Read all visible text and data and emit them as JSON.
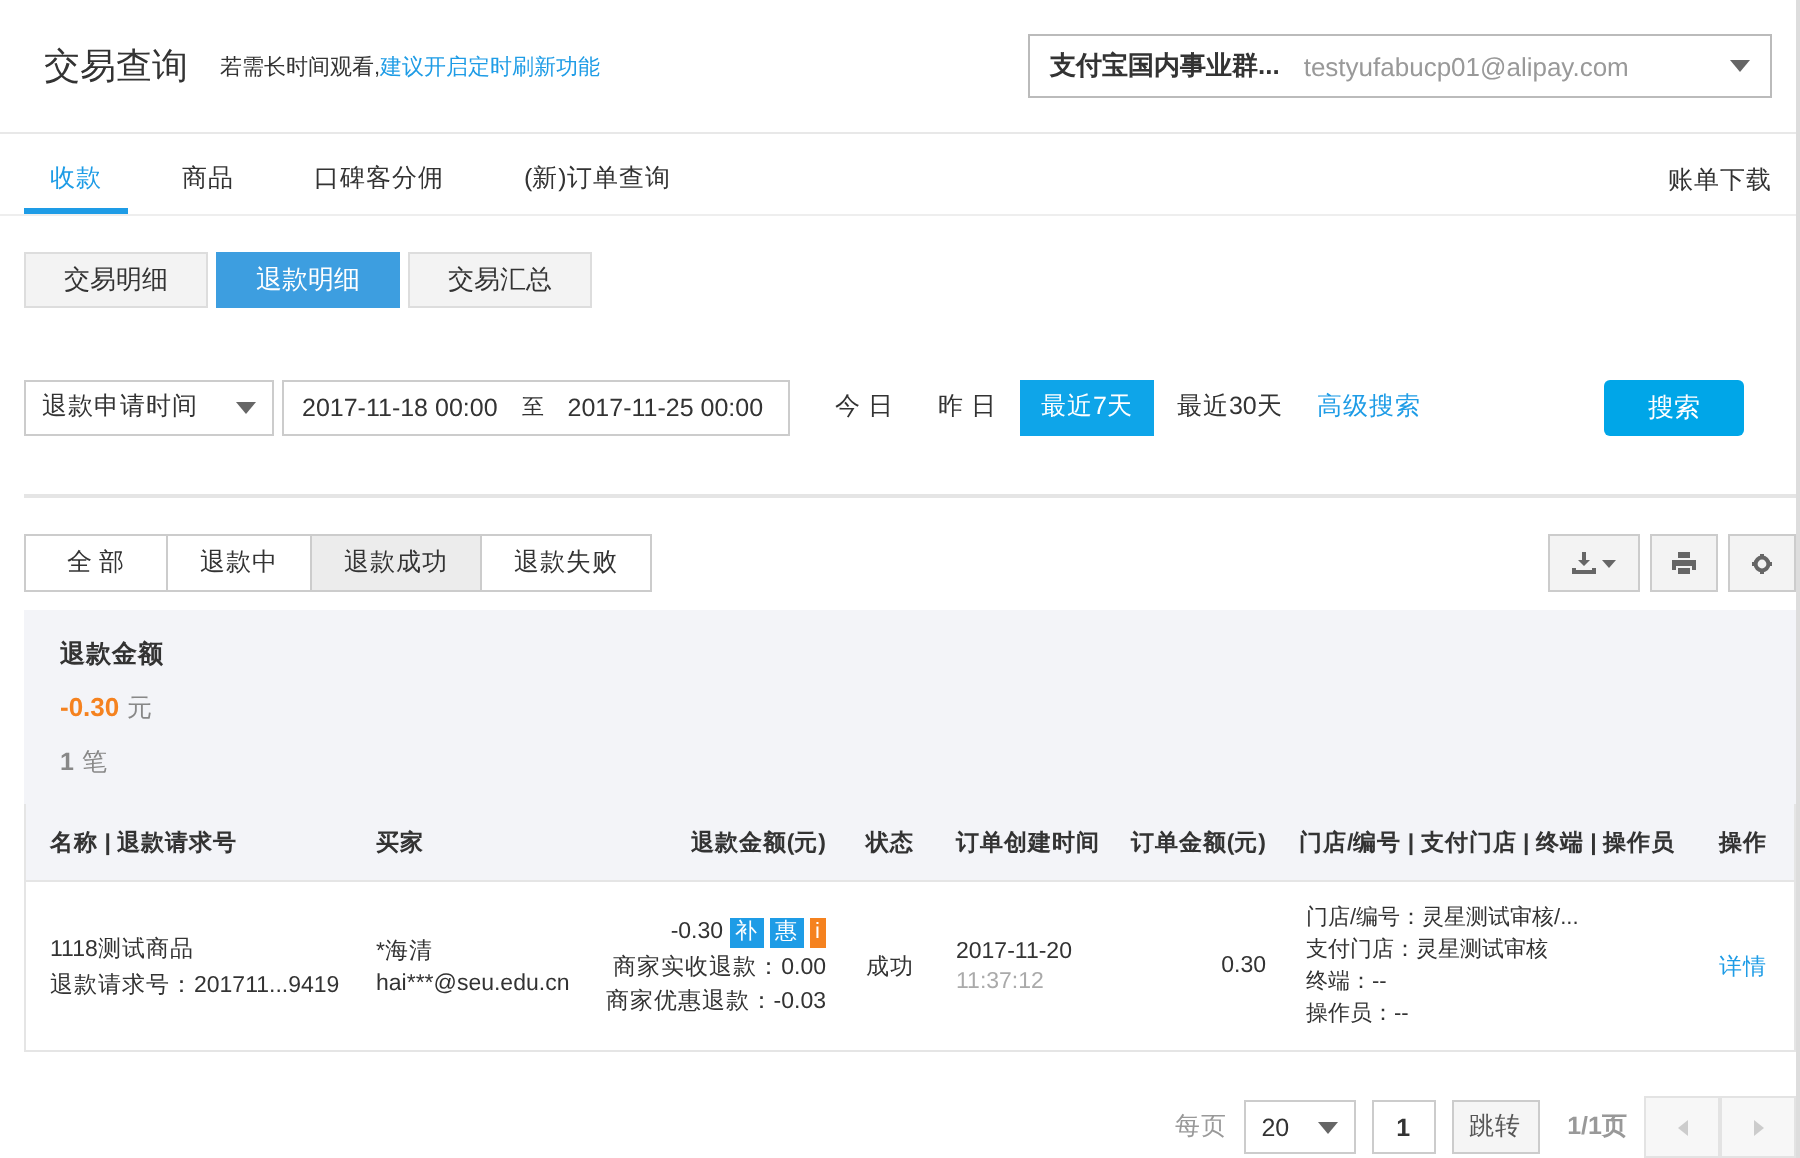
{
  "header": {
    "title": "交易查询",
    "hint": "若需长时间观看,",
    "hint_link": "建议开启定时刷新功能",
    "account": {
      "name": "支付宝国内事业群...",
      "email": "testyufabucp01@alipay.com"
    }
  },
  "nav_tabs": [
    {
      "label": "收款",
      "selected": true
    },
    {
      "label": "商品",
      "selected": false
    },
    {
      "label": "口碑客分佣",
      "selected": false
    },
    {
      "label": "(新)订单查询",
      "selected": false
    }
  ],
  "nav_right": "账单下载",
  "sub_tabs": [
    {
      "label": "交易明细",
      "selected": false
    },
    {
      "label": "退款明细",
      "selected": true
    },
    {
      "label": "交易汇总",
      "selected": false
    }
  ],
  "filter": {
    "time_type": "退款申请时间",
    "date_from": "2017-11-18 00:00",
    "date_sep": "至",
    "date_to": "2017-11-25 00:00",
    "ranges": [
      {
        "label": "今 日",
        "selected": false
      },
      {
        "label": "昨 日",
        "selected": false
      },
      {
        "label": "最近7天",
        "selected": true
      },
      {
        "label": "最近30天",
        "selected": false
      }
    ],
    "advanced": "高级搜索",
    "search": "搜索"
  },
  "status_tabs": [
    {
      "label": "全 部",
      "selected": false
    },
    {
      "label": "退款中",
      "selected": false
    },
    {
      "label": "退款成功",
      "selected": true
    },
    {
      "label": "退款失败",
      "selected": false
    }
  ],
  "summary": {
    "title": "退款金额",
    "amount": "-0.30",
    "unit": "元",
    "count": "1",
    "count_unit": "笔"
  },
  "table": {
    "columns": [
      "名称 | 退款请求号",
      "买家",
      "退款金额(元)",
      "状态",
      "订单创建时间",
      "订单金额(元)",
      "门店/编号 | 支付门店 | 终端 | 操作员",
      "操作"
    ],
    "rows": [
      {
        "name": "1118测试商品",
        "request_no": "退款请求号：201711...9419",
        "buyer_name": "*海清",
        "buyer_email": "hai***@seu.edu.cn",
        "refund": "-0.30",
        "badges": [
          {
            "text": "补",
            "color": "#1e9ce6"
          },
          {
            "text": "惠",
            "color": "#1e9ce6"
          },
          {
            "text": "i",
            "color": "#f5821f"
          }
        ],
        "merchant_received": "商家实收退款：0.00",
        "merchant_discount": "商家优惠退款：-0.03",
        "status": "成功",
        "created_date": "2017-11-20",
        "created_time": "11:37:12",
        "order_amount": "0.30",
        "store": [
          "门店/编号：灵星测试审核/...",
          "支付门店：灵星测试审核",
          "终端：--",
          "操作员：--"
        ],
        "action": "详情"
      }
    ]
  },
  "pagination": {
    "per_page_label": "每页",
    "per_page": "20",
    "page_input": "1",
    "jump": "跳转",
    "pages": "1/1页"
  }
}
